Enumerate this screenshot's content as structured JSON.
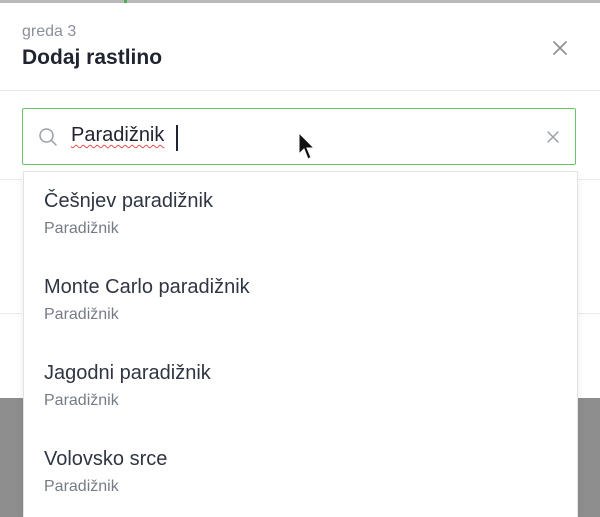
{
  "modal": {
    "subtitle": "greda 3",
    "title": "Dodaj rastlino"
  },
  "search": {
    "value": "Paradižnik"
  },
  "results": [
    {
      "name": "Češnjev paradižnik",
      "category": "Paradižnik"
    },
    {
      "name": "Monte Carlo paradižnik",
      "category": "Paradižnik"
    },
    {
      "name": "Jagodni paradižnik",
      "category": "Paradižnik"
    },
    {
      "name": "Volovsko srce",
      "category": "Paradižnik"
    }
  ],
  "colors": {
    "accent": "#6cc26c",
    "title": "#1f2430",
    "muted": "#767c86",
    "backdrop": "#8e8e8e"
  }
}
